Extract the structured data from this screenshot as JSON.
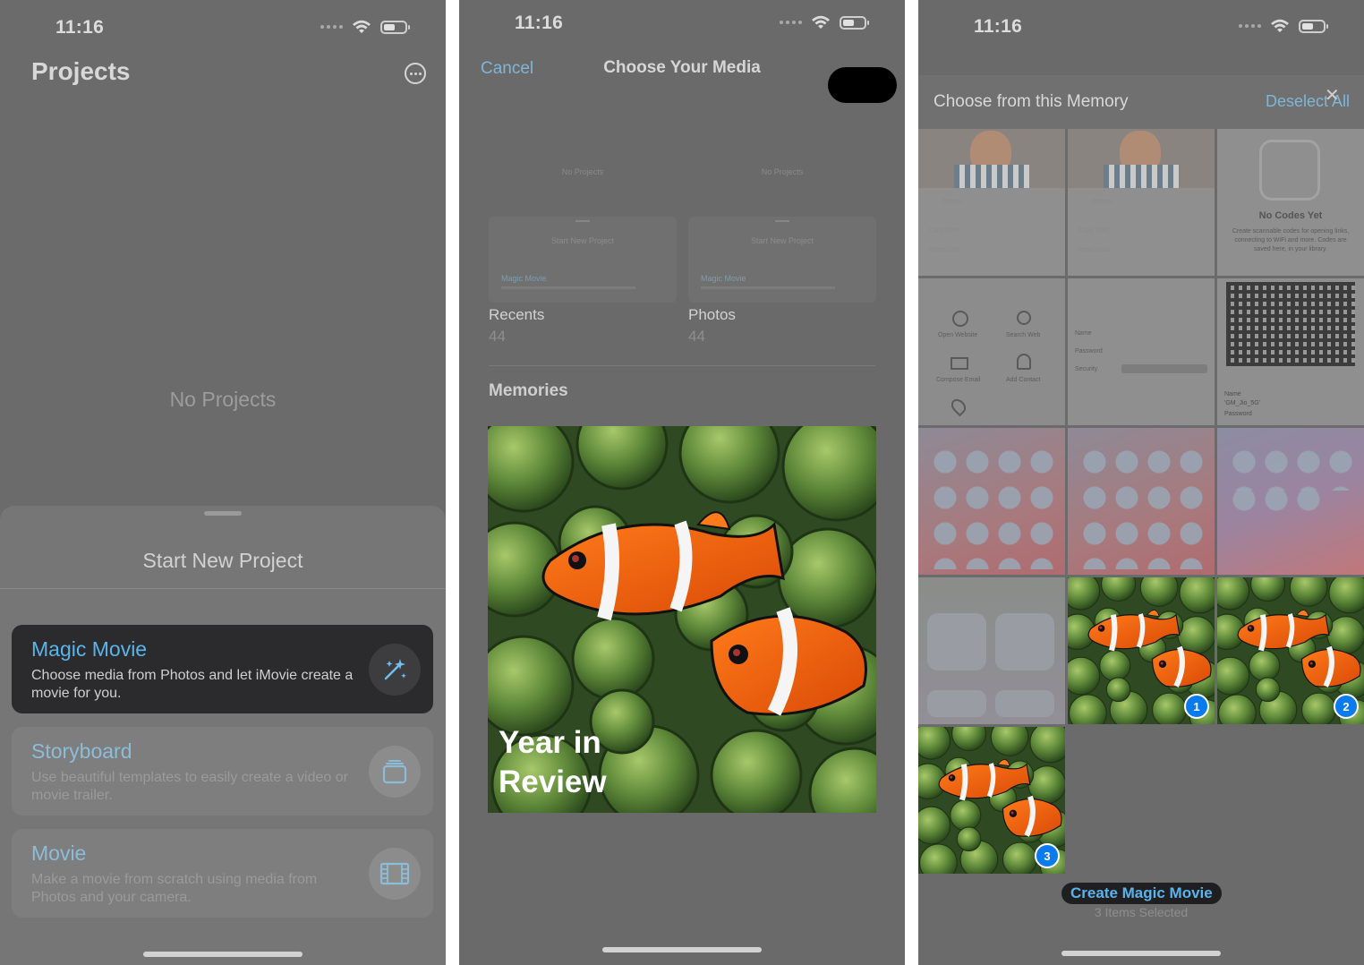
{
  "panel1": {
    "status": {
      "time": "11:16"
    },
    "title": "Projects",
    "empty_text": "No Projects",
    "sheet": {
      "title": "Start New Project",
      "options": [
        {
          "title": "Magic Movie",
          "description": "Choose media from Photos and let iMovie create a movie for you.",
          "icon": "magic-wand-icon",
          "selected": true
        },
        {
          "title": "Storyboard",
          "description": "Use beautiful templates to easily create a video or movie trailer.",
          "icon": "storyboard-icon",
          "selected": false
        },
        {
          "title": "Movie",
          "description": "Make a movie from scratch using media from Photos and your camera.",
          "icon": "film-icon",
          "selected": false
        }
      ]
    }
  },
  "panel2": {
    "status": {
      "time": "11:16"
    },
    "cancel_label": "Cancel",
    "title": "Choose Your Media",
    "albums": [
      {
        "name": "Recents",
        "count": "44",
        "thumb_empty": "No Projects",
        "thumb_title": "Start New Project",
        "thumb_option": "Magic Movie"
      },
      {
        "name": "Photos",
        "count": "44",
        "thumb_empty": "No Projects",
        "thumb_title": "Start New Project",
        "thumb_option": "Magic Movie"
      }
    ],
    "memories_label": "Memories",
    "memory": {
      "title_line1": "Year in",
      "title_line2": "Review"
    }
  },
  "panel3": {
    "status": {
      "time": "11:16"
    },
    "title": "Choose from this Memory",
    "deselect_label": "Deselect All",
    "thumbs": {
      "options_label": "Options",
      "copy_edits": "Copy Edits",
      "paste_edits": "Paste Edits",
      "no_codes_title": "No Codes Yet",
      "no_codes_desc": "Create scannable codes for opening links, connecting to WiFi and more. Codes are saved here, in your library.",
      "open_website": "Open Website",
      "search_web": "Search Web",
      "compose_email": "Compose Email",
      "add_contact": "Add Contact",
      "name_label": "Name",
      "password_label": "Password",
      "security_label": "Security",
      "wifi_name": "'GM_Jio_5G'"
    },
    "selection_badges": [
      "1",
      "2",
      "3"
    ],
    "create_label": "Create Magic Movie",
    "selected_count": "3 Items Selected"
  },
  "colors": {
    "accent": "#5ab4ec",
    "badge": "#0a7bef",
    "dim": "#6b6b6b"
  }
}
